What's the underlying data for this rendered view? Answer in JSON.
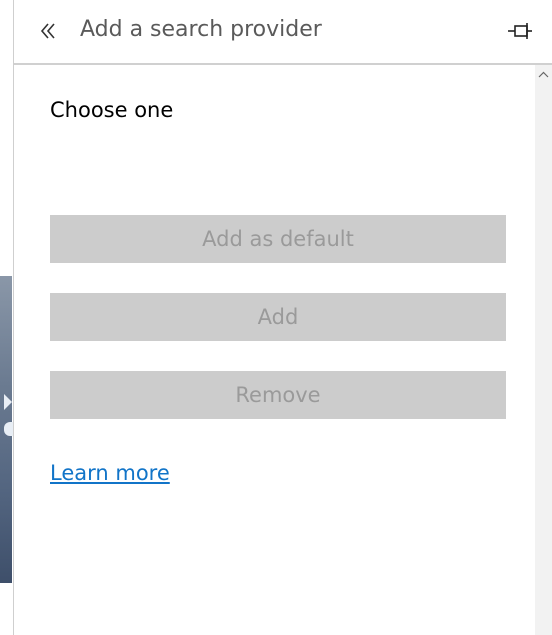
{
  "header": {
    "title": "Add a search provider",
    "back_icon": "double-chevron-left-icon",
    "pin_icon": "pin-icon"
  },
  "content": {
    "choose_label": "Choose one",
    "buttons": {
      "add_as_default": "Add as default",
      "add": "Add",
      "remove": "Remove"
    },
    "buttons_state": "disabled",
    "learn_more": "Learn more"
  },
  "colors": {
    "button_bg": "#cccccc",
    "button_text": "#9a9a9a",
    "link": "#1174c8",
    "title_text": "#5a5a5a"
  }
}
